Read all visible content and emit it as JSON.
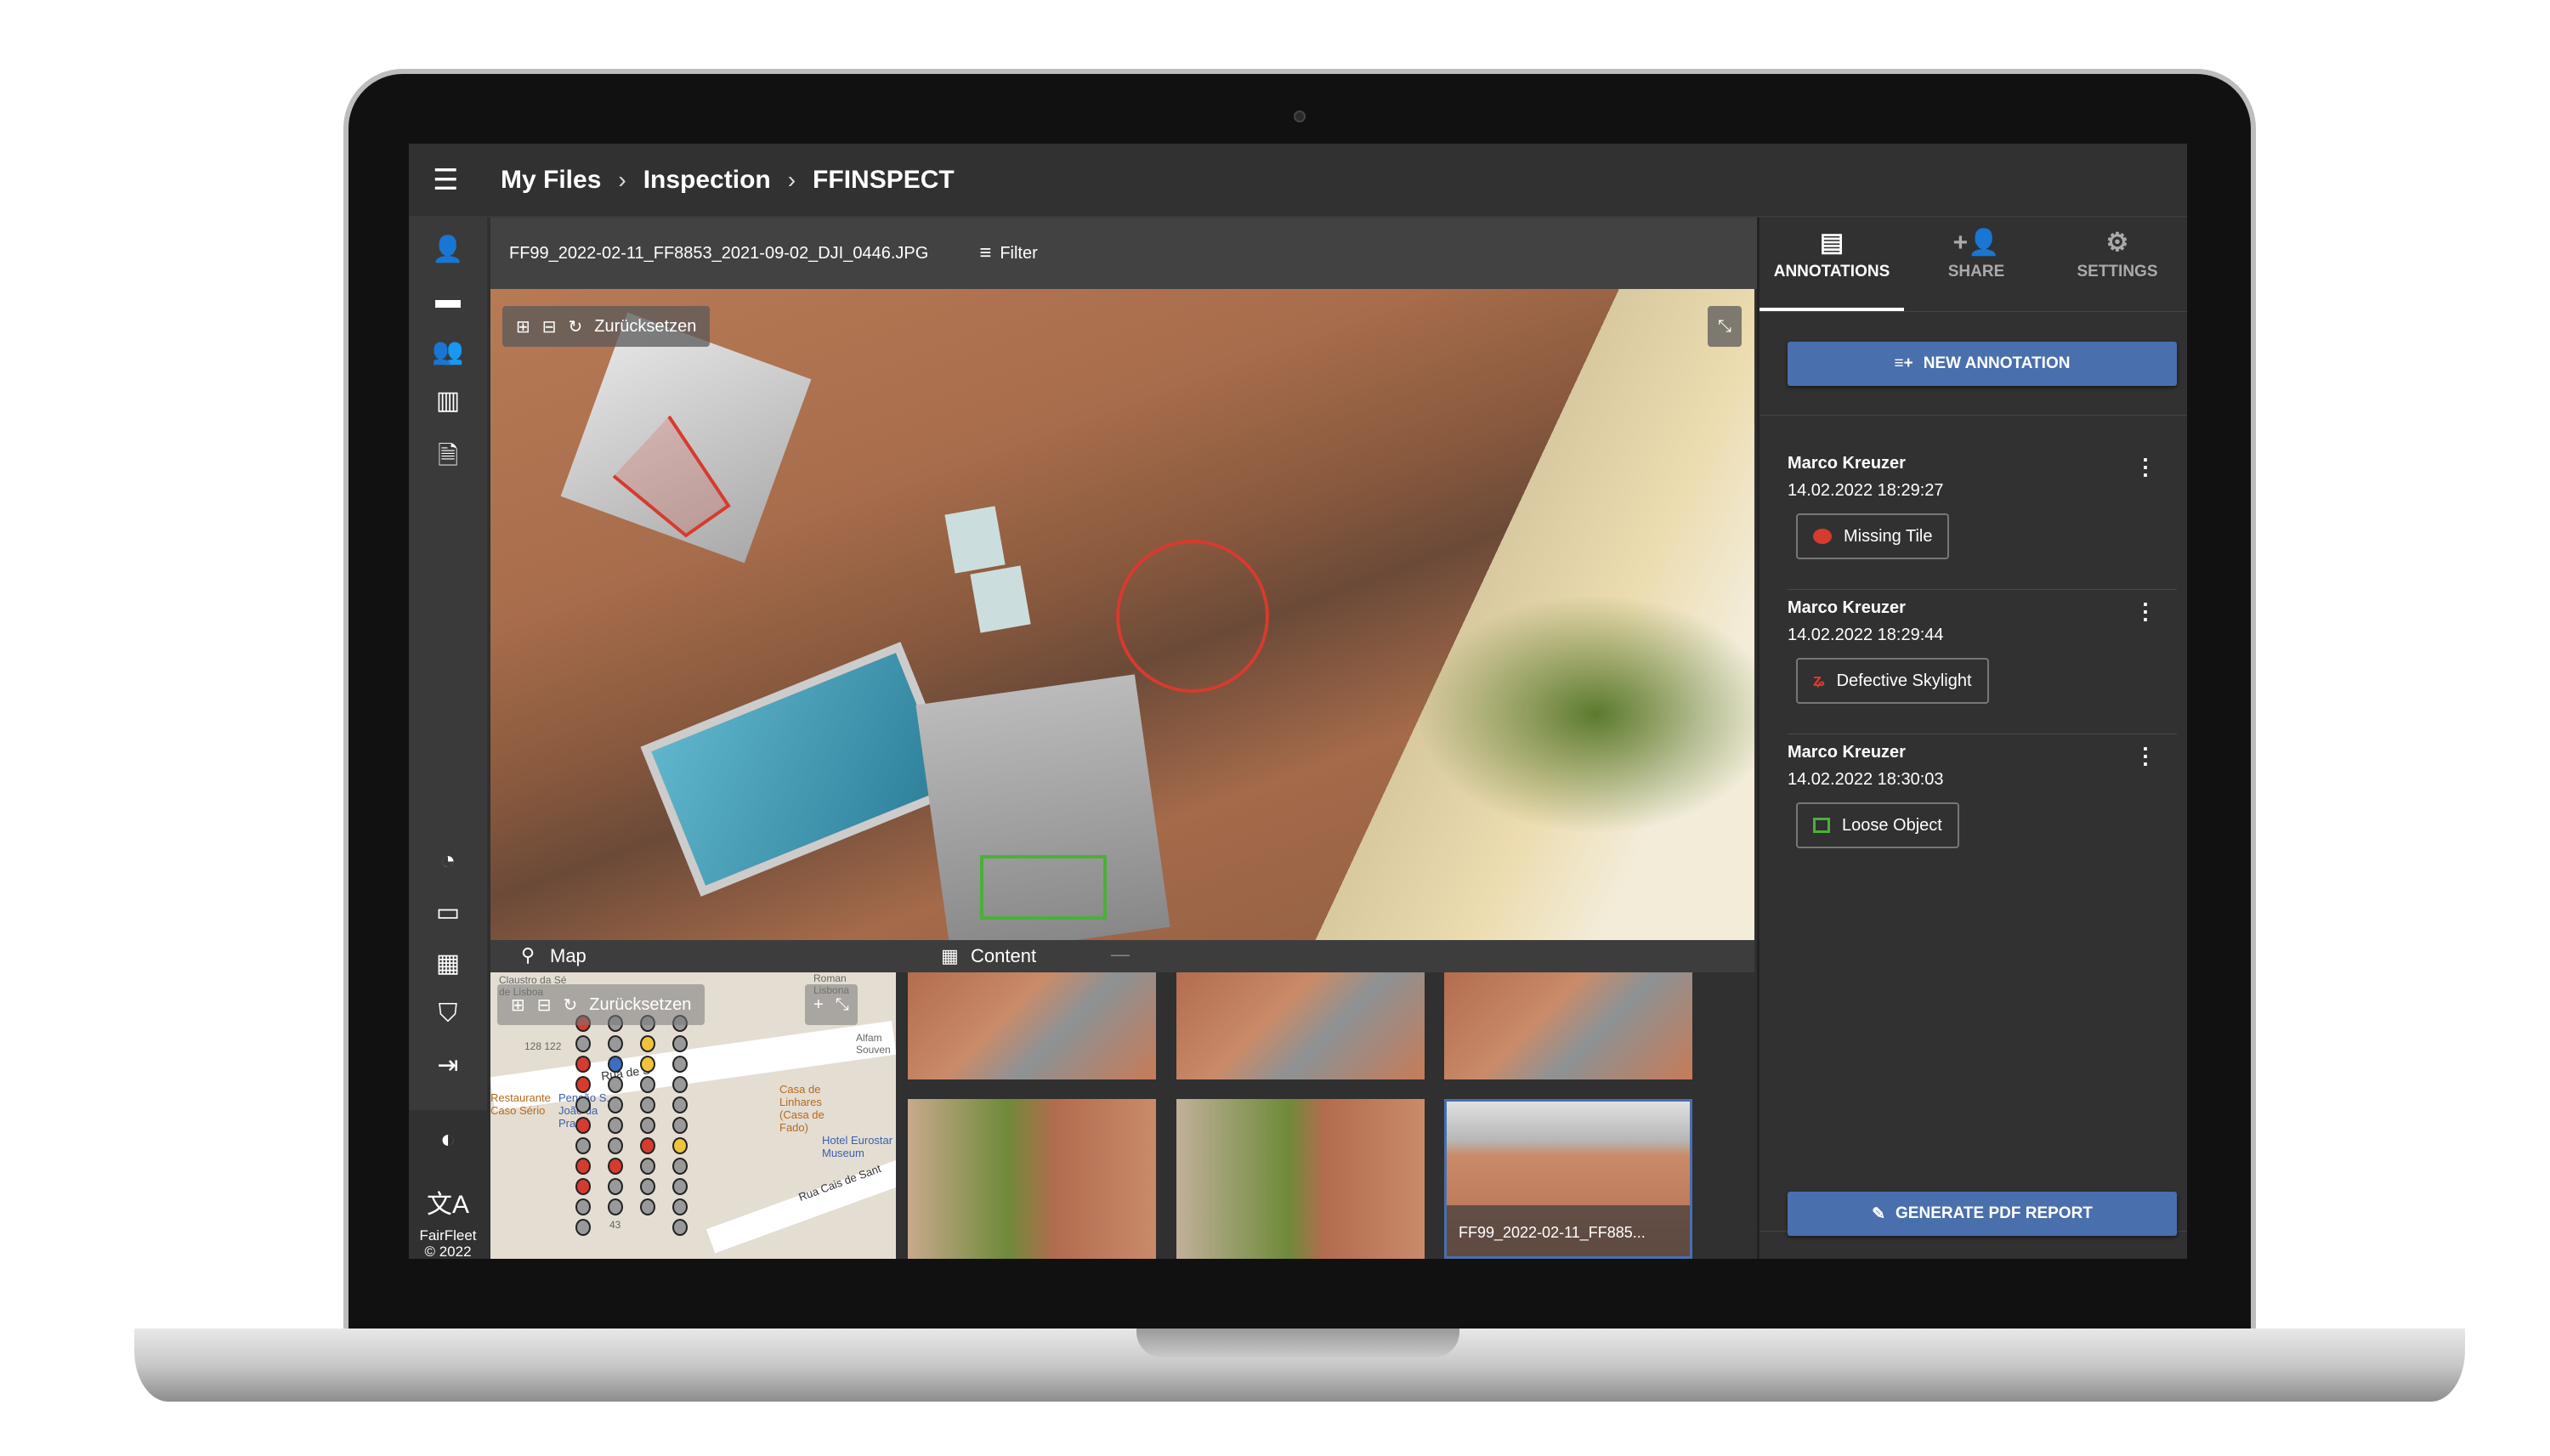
{
  "header": {
    "breadcrumbs": [
      "My Files",
      "Inspection",
      "FFINSPECT"
    ],
    "menu_icon": "menu-icon"
  },
  "sidebar": {
    "top_icons": [
      "account-icon",
      "folder-icon",
      "people-icon",
      "map-icon",
      "file-check-icon"
    ],
    "bottom_icons": [
      "rss-icon",
      "chat-icon",
      "building-icon",
      "shield-search-icon",
      "logout-icon"
    ],
    "theme_icon": "brightness-icon",
    "language_icon": "translate-icon",
    "brand": "FairFleet",
    "copyright": "© 2022"
  },
  "toolbar": {
    "filename": "FF99_2022-02-11_FF8853_2021-09-02_DJI_0446.JPG",
    "filter_label": "Filter"
  },
  "viewer": {
    "reset_label": "Zurücksetzen"
  },
  "map": {
    "title": "Map",
    "reset_label": "Zurücksetzen",
    "labels": [
      "Claustro da Sé de Lisboa",
      "Roman Lisbona",
      "Rua de S",
      "Restaurante Caso Sério",
      "Pensão S. João da Praça",
      "Casa de Linhares (Casa de Fado)",
      "Hotel Eurostar Museum",
      "Rua Cais de Sant",
      "Alfam Souven",
      "128 122",
      "43"
    ]
  },
  "content": {
    "title": "Content",
    "selected_caption": "FF99_2022-02-11_FF885..."
  },
  "panel": {
    "tabs": [
      {
        "label": "ANNOTATIONS",
        "icon": "comment-icon",
        "active": true
      },
      {
        "label": "SHARE",
        "icon": "person-add-icon"
      },
      {
        "label": "SETTINGS",
        "icon": "gear-icon"
      }
    ],
    "new_annotation": "NEW ANNOTATION",
    "annotations": [
      {
        "author": "Marco Kreuzer",
        "date": "14.02.2022 18:29:27",
        "label": "Missing Tile",
        "shape": "circle",
        "color": "#d63b2f"
      },
      {
        "author": "Marco Kreuzer",
        "date": "14.02.2022 18:29:44",
        "label": "Defective Skylight",
        "shape": "freehand",
        "color": "#d63b2f"
      },
      {
        "author": "Marco Kreuzer",
        "date": "14.02.2022 18:30:03",
        "label": "Loose Object",
        "shape": "rectangle",
        "color": "#4caf3a"
      }
    ],
    "report": "GENERATE PDF REPORT"
  },
  "colors": {
    "accent": "#4a6fad",
    "background": "#303130"
  }
}
